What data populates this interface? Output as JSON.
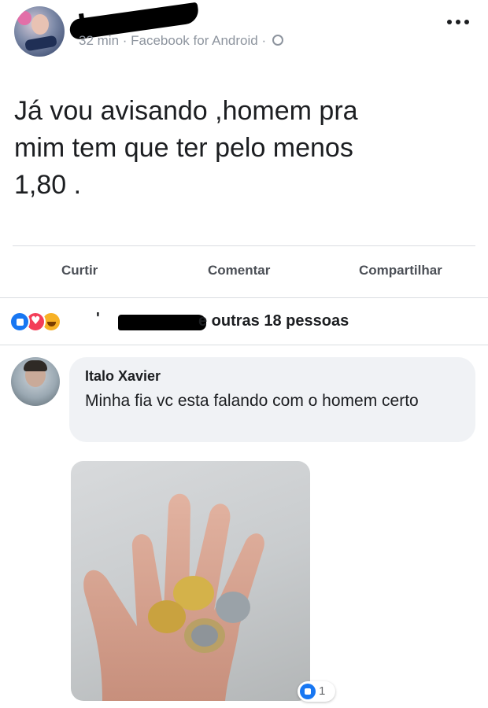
{
  "post": {
    "meta": "32 min · Facebook for Android ·",
    "text": "Já vou avisando ,homem pra\nmim tem que ter pelo menos\n1,80 ."
  },
  "actions": {
    "like": "Curtir",
    "comment": "Comentar",
    "share": "Compartilhar"
  },
  "reactions": {
    "apostrophe": "'",
    "summary": "e outras 18 pessoas",
    "types": [
      "like",
      "love",
      "haha"
    ]
  },
  "comment": {
    "author": "Italo Xavier",
    "text": "Minha fia vc esta falando com o homem certo",
    "like_count": "1"
  },
  "colors": {
    "accent": "#1877f2",
    "love": "#f33e58",
    "haha": "#f7b125",
    "meta_text": "#8d949e",
    "bubble": "#f0f2f5"
  }
}
